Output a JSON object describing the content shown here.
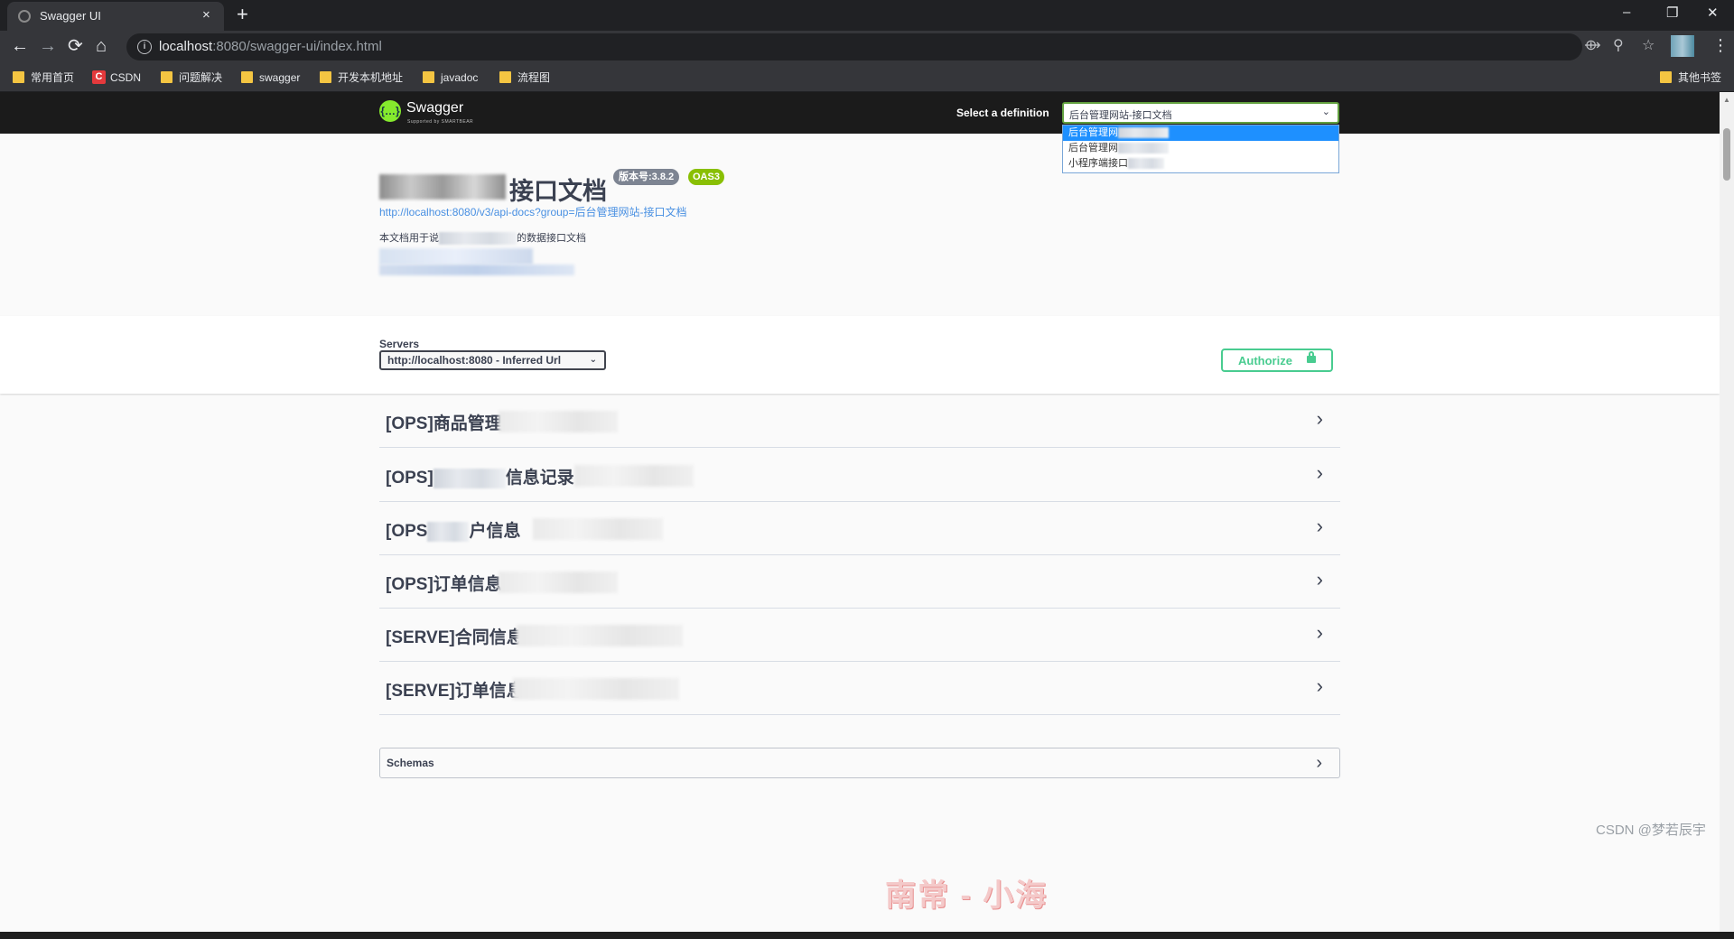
{
  "browser": {
    "tab_title": "Swagger UI",
    "tab_close": "×",
    "new_tab": "+",
    "url_host": "localhost",
    "url_path": ":8080/swagger-ui/index.html",
    "window_controls": {
      "minimize": "–",
      "restore": "❐",
      "close": "✕"
    },
    "nav": {
      "back": "←",
      "forward": "→",
      "reload": "⟳",
      "home": "⌂"
    },
    "bookmarks": [
      "常用首页",
      "CSDN",
      "问题解决",
      "swagger",
      "开发本机地址",
      "javadoc",
      "流程图"
    ],
    "other_bookmarks": "其他书签",
    "csdn_icon_letter": "C"
  },
  "swagger": {
    "logo_mark": "{…}",
    "brand": "Swagger",
    "brand_sub": "Supported by SMARTBEAR",
    "select_label": "Select a definition",
    "selected_definition": "后台管理网站-接口文档",
    "definition_options": [
      "后台管理网",
      "后台管理网",
      "小程序端接口"
    ]
  },
  "info": {
    "title": "接口文档",
    "version_badge": "版本号:3.8.2",
    "oas_badge": "OAS3",
    "api_url": "http://localhost:8080/v3/api-docs?group=后台管理网站-接口文档",
    "description_prefix": "本文档用于说",
    "description_suffix": "的数据接口文档"
  },
  "servers": {
    "label": "Servers",
    "selected": "http://localhost:8080 - Inferred Url"
  },
  "authorize_label": "Authorize",
  "tags": [
    {
      "name": "[OPS]商品管理"
    },
    {
      "name": "[OPS]",
      "name_suffix": "信息记录"
    },
    {
      "name": "[OPS",
      "name_suffix": "户信息"
    },
    {
      "name": "[OPS]订单信息"
    },
    {
      "name": "[SERVE]合同信息"
    },
    {
      "name": "[SERVE]订单信息"
    }
  ],
  "schemas_label": "Schemas",
  "watermarks": {
    "center": "南常 - 小海",
    "corner": "CSDN @梦若辰宇"
  },
  "colors": {
    "swagger_green": "#85ea2d",
    "authorize_green": "#49cc90",
    "oas_green": "#89bf04",
    "link_blue": "#4990e2",
    "topbar": "#1b1b1b"
  }
}
